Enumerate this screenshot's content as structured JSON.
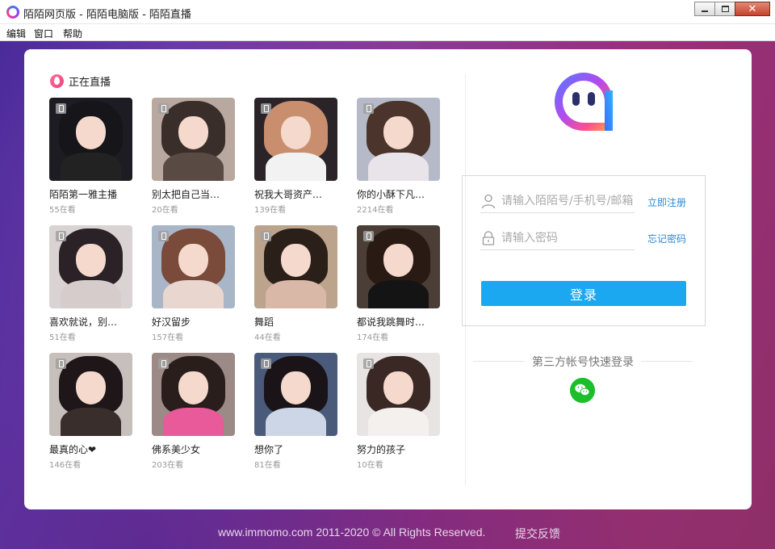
{
  "window": {
    "title": "陌陌网页版 - 陌陌电脑版 - 陌陌直播",
    "minimize_icon": "minimize-icon",
    "maximize_icon": "maximize-icon",
    "close_label": "✕"
  },
  "menu": {
    "items": [
      "编辑",
      "窗口",
      "帮助"
    ]
  },
  "live": {
    "title": "正在直播",
    "streams": [
      {
        "name": "陌陌第一雅主播",
        "viewers": "55在看",
        "bg": "#1c1c22",
        "hair": "#15151a",
        "body": "#222"
      },
      {
        "name": "别太把自己当…",
        "viewers": "20在看",
        "bg": "#b9a89f",
        "hair": "#3a2e2a",
        "body": "#5a4a44"
      },
      {
        "name": "祝我大哥资产…",
        "viewers": "139在看",
        "bg": "#2a2428",
        "hair": "#c88e6e",
        "body": "#f2f2f2"
      },
      {
        "name": "你的小酥下凡…",
        "viewers": "2214在看",
        "bg": "#b6b9c8",
        "hair": "#4a342c",
        "body": "#e9e4ea"
      },
      {
        "name": "喜欢就说，别…",
        "viewers": "51在看",
        "bg": "#d9d4d3",
        "hair": "#2a2226",
        "body": "#d7cccc"
      },
      {
        "name": "好汉留步",
        "viewers": "157在看",
        "bg": "#a8b6c8",
        "hair": "#7a4a3a",
        "body": "#e9d6cf"
      },
      {
        "name": "舞蹈",
        "viewers": "44在看",
        "bg": "#bca48c",
        "hair": "#2b1f1a",
        "body": "#d9b8a8"
      },
      {
        "name": "都说我跳舞时…",
        "viewers": "174在看",
        "bg": "#4a3e36",
        "hair": "#2a1a14",
        "body": "#141414"
      },
      {
        "name": "最真的心❤",
        "viewers": "146在看",
        "bg": "#c6bfbb",
        "hair": "#1e1618",
        "body": "#3a2e2c"
      },
      {
        "name": "佛系美少女",
        "viewers": "203在看",
        "bg": "#9c8a86",
        "hair": "#2a1e1c",
        "body": "#e85a9a"
      },
      {
        "name": "想你了",
        "viewers": "81在看",
        "bg": "#4a5a7a",
        "hair": "#1a1418",
        "body": "#cdd6e6"
      },
      {
        "name": "努力的孩子",
        "viewers": "10在看",
        "bg": "#e8e4e4",
        "hair": "#3a2824",
        "body": "#f4f0ee"
      }
    ]
  },
  "login": {
    "username_placeholder": "请输入陌陌号/手机号/邮箱",
    "password_placeholder": "请输入密码",
    "register_label": "立即注册",
    "forgot_label": "忘记密码",
    "submit_label": "登录",
    "third_party_label": "第三方帐号快速登录"
  },
  "footer": {
    "copyright": "www.immomo.com 2011-2020 © All Rights Reserved.",
    "feedback_label": "提交反馈"
  },
  "colors": {
    "accent": "#1ba8f0",
    "link": "#2a8ad4",
    "wechat": "#1bbf2a"
  }
}
